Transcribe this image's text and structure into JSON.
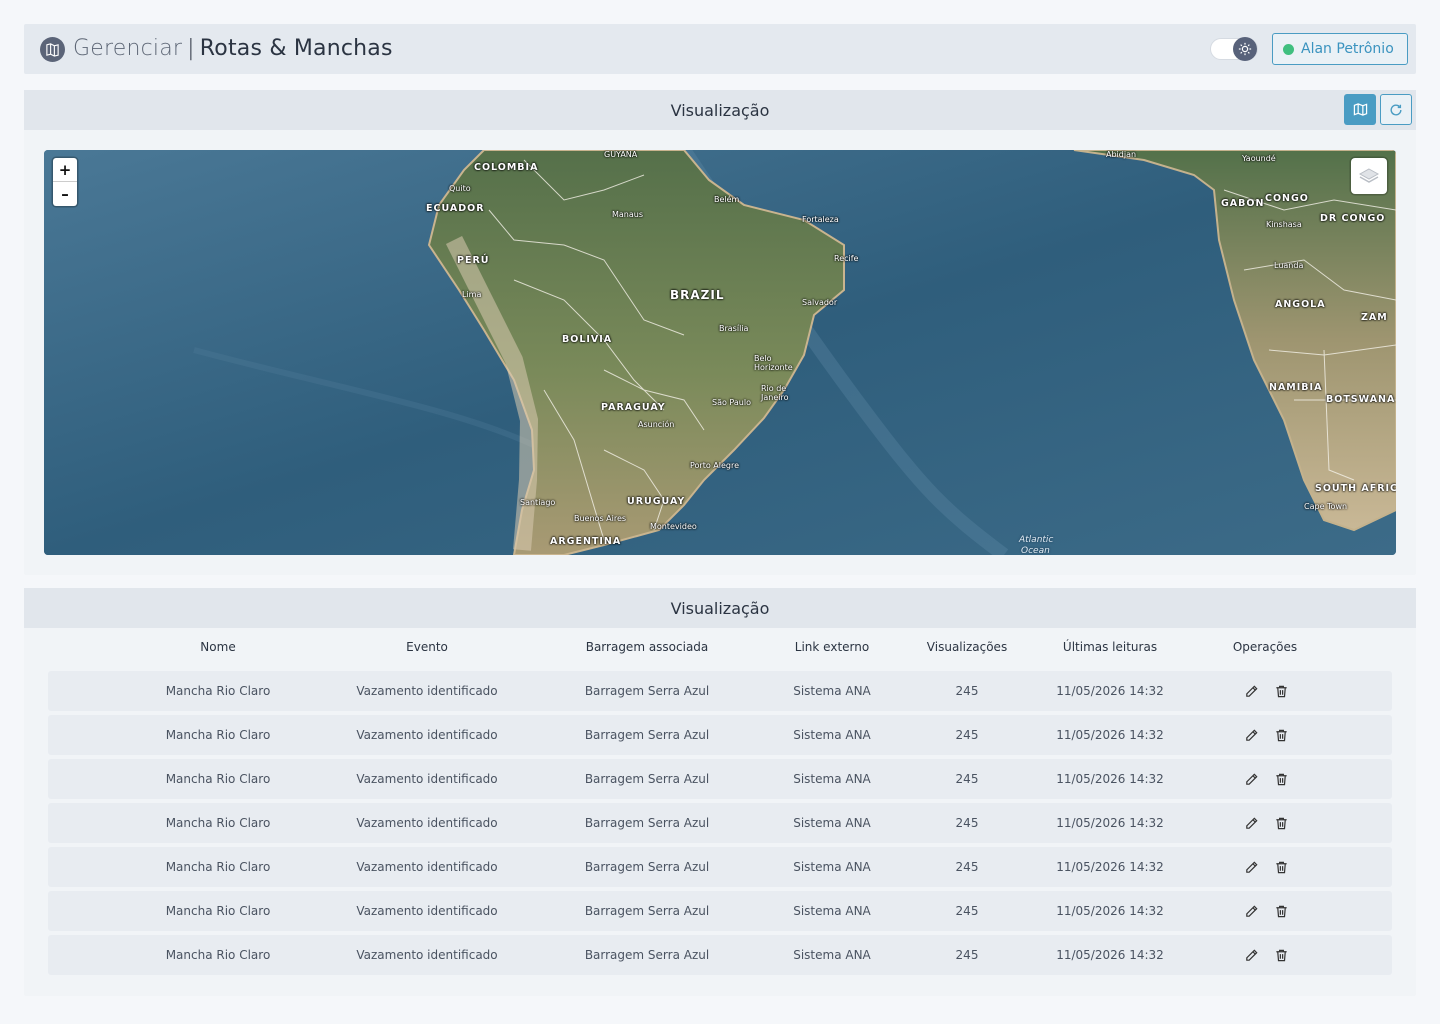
{
  "header": {
    "title_prefix": "Gerenciar",
    "separator": "|",
    "title_main": "Rotas & Manchas",
    "user_name": "Alan Petrônio",
    "icons": {
      "logo": "map-book-icon",
      "theme": "sun-icon"
    }
  },
  "map_panel": {
    "title": "Visualização",
    "zoom_in": "+",
    "zoom_out": "–",
    "labels": {
      "guyana": "GUYANA",
      "colombia": "COLOMBIA",
      "quito": "Quito",
      "ecuador": "ECUADOR",
      "manaus": "Manaus",
      "belem": "Belém",
      "fortaleza": "Fortaleza",
      "recife": "Recife",
      "peru": "PERÚ",
      "lima": "Lima",
      "brazil": "BRAZIL",
      "salvador": "Salvador",
      "bolivia": "BOLIVIA",
      "brasilia": "Brasília",
      "belo_horizonte": "Belo Horizonte",
      "rio": "Rio de Janeiro",
      "sao_paulo": "São Paulo",
      "paraguay": "PARAGUAY",
      "asuncion": "Asunción",
      "porto_alegre": "Porto Alegre",
      "santiago": "Santiago",
      "uruguay": "URUGUAY",
      "buenos_aires": "Buenos Aires",
      "montevideo": "Montevideo",
      "argentina": "ARGENTINA",
      "atlantic": "Atlantic",
      "ocean": "Ocean",
      "abidjan": "Abidjan",
      "yaounde": "Yaoundé",
      "gabon": "GABON",
      "congo": "CONGO",
      "kinshasa": "Kinshasa",
      "dr_congo": "DR CONGO",
      "luanda": "Luanda",
      "angola": "ANGOLA",
      "zambia": "ZAM",
      "namibia": "NAMIBIA",
      "botswana": "BOTSWANA",
      "south_africa": "SOUTH AFRICA",
      "cape_town": "Cape Town"
    }
  },
  "table_panel": {
    "title": "Visualização",
    "columns": [
      "Nome",
      "Evento",
      "Barragem associada",
      "Link externo",
      "Visualizações",
      "Últimas leituras",
      "Operações"
    ],
    "rows": [
      [
        "Mancha Rio Claro",
        "Vazamento identificado",
        "Barragem Serra Azul",
        "Sistema ANA",
        "245",
        "11/05/2026 14:32"
      ],
      [
        "Mancha Rio Claro",
        "Vazamento identificado",
        "Barragem Serra Azul",
        "Sistema ANA",
        "245",
        "11/05/2026 14:32"
      ],
      [
        "Mancha Rio Claro",
        "Vazamento identificado",
        "Barragem Serra Azul",
        "Sistema ANA",
        "245",
        "11/05/2026 14:32"
      ],
      [
        "Mancha Rio Claro",
        "Vazamento identificado",
        "Barragem Serra Azul",
        "Sistema ANA",
        "245",
        "11/05/2026 14:32"
      ],
      [
        "Mancha Rio Claro",
        "Vazamento identificado",
        "Barragem Serra Azul",
        "Sistema ANA",
        "245",
        "11/05/2026 14:32"
      ],
      [
        "Mancha Rio Claro",
        "Vazamento identificado",
        "Barragem Serra Azul",
        "Sistema ANA",
        "245",
        "11/05/2026 14:32"
      ],
      [
        "Mancha Rio Claro",
        "Vazamento identificado",
        "Barragem Serra Azul",
        "Sistema ANA",
        "245",
        "11/05/2026 14:32"
      ]
    ]
  },
  "colors": {
    "accent": "#4a9cc3",
    "online": "#3fbf7f",
    "panel_head": "#e1e6ec"
  }
}
